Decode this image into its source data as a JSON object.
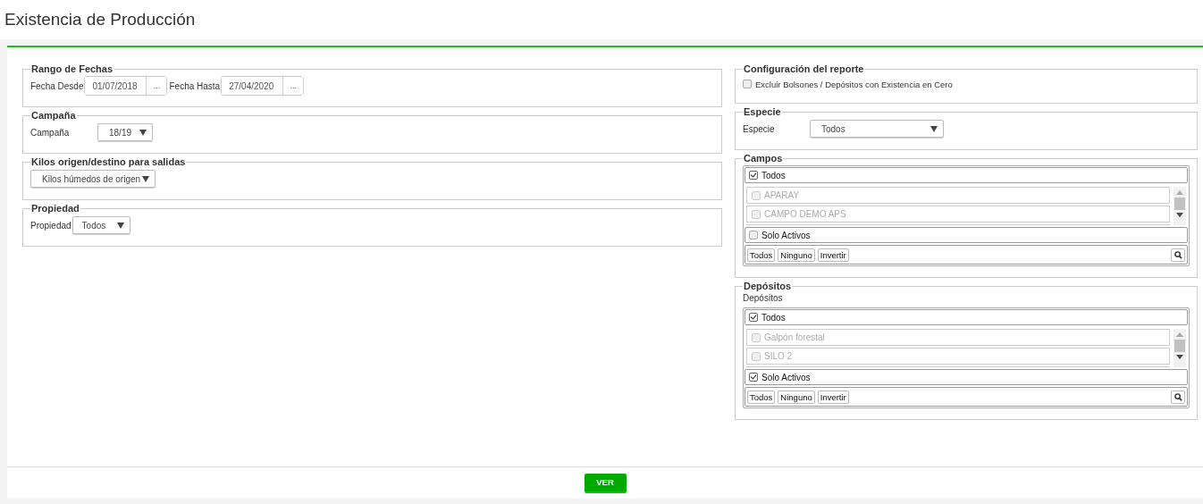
{
  "page_title": "Existencia de Producción",
  "left_sections": [
    {
      "kind": "dates",
      "legend": "Rango de Fechas",
      "fields": [
        {
          "label": "Fecha Desde",
          "value": "01/07/2018",
          "button": "..."
        },
        {
          "label": "Fecha Hasta",
          "value": "27/04/2020",
          "button": "..."
        }
      ]
    },
    {
      "kind": "select",
      "legend": "Campaña",
      "label": "Campaña",
      "value": "18/19"
    },
    {
      "kind": "select",
      "legend": "Kilos origen/destino para salidas",
      "value": "Kilos húmedos de origen"
    },
    {
      "kind": "select",
      "legend": "Propiedad",
      "label": "Propiedad",
      "value": "Todos"
    }
  ],
  "report_config": {
    "legend": "Configuración del reporte",
    "option": {
      "label": "Excluir Bolsones / Depósitos con Existencia en Cero",
      "checked": false
    }
  },
  "especie": {
    "legend": "Especie",
    "label": "Especie",
    "value": "Todos"
  },
  "pickers": [
    {
      "legend": "Campos",
      "all": {
        "label": "Todos",
        "checked": true
      },
      "items": [
        {
          "label": "APARAY",
          "checked": false,
          "disabled": true
        },
        {
          "label": "CAMPO DEMO APS",
          "checked": false,
          "disabled": true
        }
      ],
      "solo_activos": {
        "label": "Solo Activos",
        "checked": false
      },
      "buttons": [
        "Todos",
        "Ninguno",
        "Invertir"
      ]
    },
    {
      "legend": "Depósitos",
      "label": "Depósitos",
      "all": {
        "label": "Todos",
        "checked": true
      },
      "items": [
        {
          "label": "Galpón forestal",
          "checked": false,
          "disabled": true
        },
        {
          "label": "SILO 2",
          "checked": false,
          "disabled": true
        }
      ],
      "solo_activos": {
        "label": "Solo Activos",
        "checked": true
      },
      "buttons": [
        "Todos",
        "Ninguno",
        "Invertir"
      ]
    }
  ],
  "submit": "VER"
}
